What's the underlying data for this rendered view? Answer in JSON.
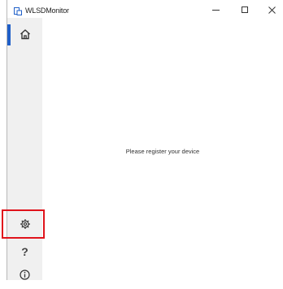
{
  "window": {
    "title": "WLSDMonitor"
  },
  "titlebar": {
    "minimize_glyph": "–",
    "maximize_glyph": "□",
    "close_glyph": "✕"
  },
  "sidebar": {
    "items": [
      {
        "id": "home",
        "icon": "home-icon",
        "active": true
      },
      {
        "id": "settings",
        "icon": "gear-icon",
        "active": false
      },
      {
        "id": "help",
        "icon": "question-icon",
        "label": "?",
        "active": false
      },
      {
        "id": "about",
        "icon": "info-icon",
        "active": false
      }
    ],
    "accent_color": "#1f5fc8",
    "highlight_color": "#e0131b"
  },
  "main": {
    "message": "Please register your device"
  }
}
